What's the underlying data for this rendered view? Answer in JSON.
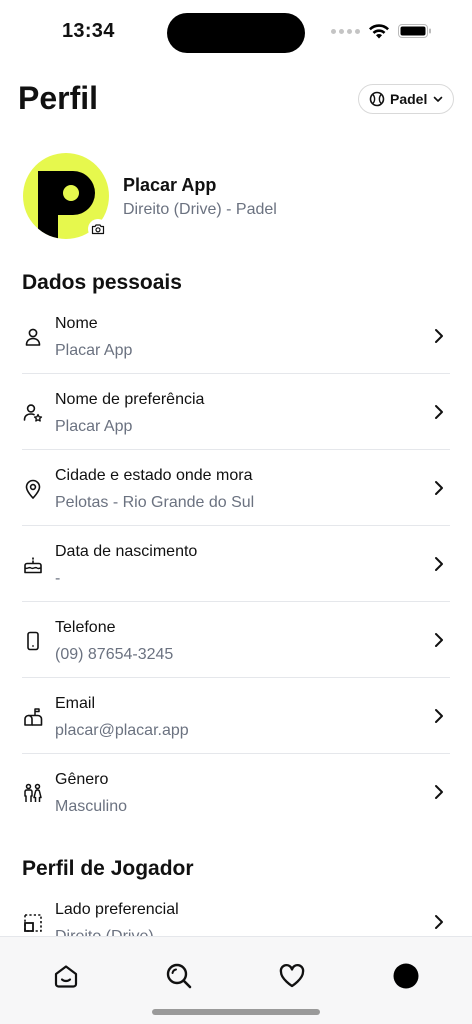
{
  "status_bar": {
    "time": "13:34"
  },
  "header": {
    "title": "Perfil",
    "sport_selector": "Padel"
  },
  "profile": {
    "name": "Placar App",
    "subtitle": "Direito (Drive) - Padel",
    "avatar_letter": "p",
    "avatar_color": "#e6f84d"
  },
  "personal_section": {
    "title": "Dados pessoais",
    "items": [
      {
        "label": "Nome",
        "value": "Placar App",
        "icon": "user-icon"
      },
      {
        "label": "Nome de preferência",
        "value": "Placar App",
        "icon": "user-star-icon"
      },
      {
        "label": "Cidade e estado onde mora",
        "value": "Pelotas - Rio Grande do Sul",
        "icon": "map-pin-icon"
      },
      {
        "label": "Data de nascimento",
        "value": "-",
        "icon": "cake-icon"
      },
      {
        "label": "Telefone",
        "value": "(09) 87654-3245",
        "icon": "phone-icon"
      },
      {
        "label": "Email",
        "value": "placar@placar.app",
        "icon": "mailbox-icon"
      },
      {
        "label": "Gênero",
        "value": "Masculino",
        "icon": "people-icon"
      }
    ]
  },
  "player_section": {
    "title": "Perfil de Jogador",
    "items": [
      {
        "label": "Lado preferencial",
        "value": "Direito (Drive)",
        "icon": "court-side-icon"
      }
    ]
  },
  "bottom_nav": [
    "home-icon",
    "search-icon",
    "heart-icon",
    "profile-dot-icon"
  ],
  "colors": {
    "accent": "#e6f84d",
    "text_secondary": "#6b7280",
    "divider": "#e5e7eb"
  }
}
